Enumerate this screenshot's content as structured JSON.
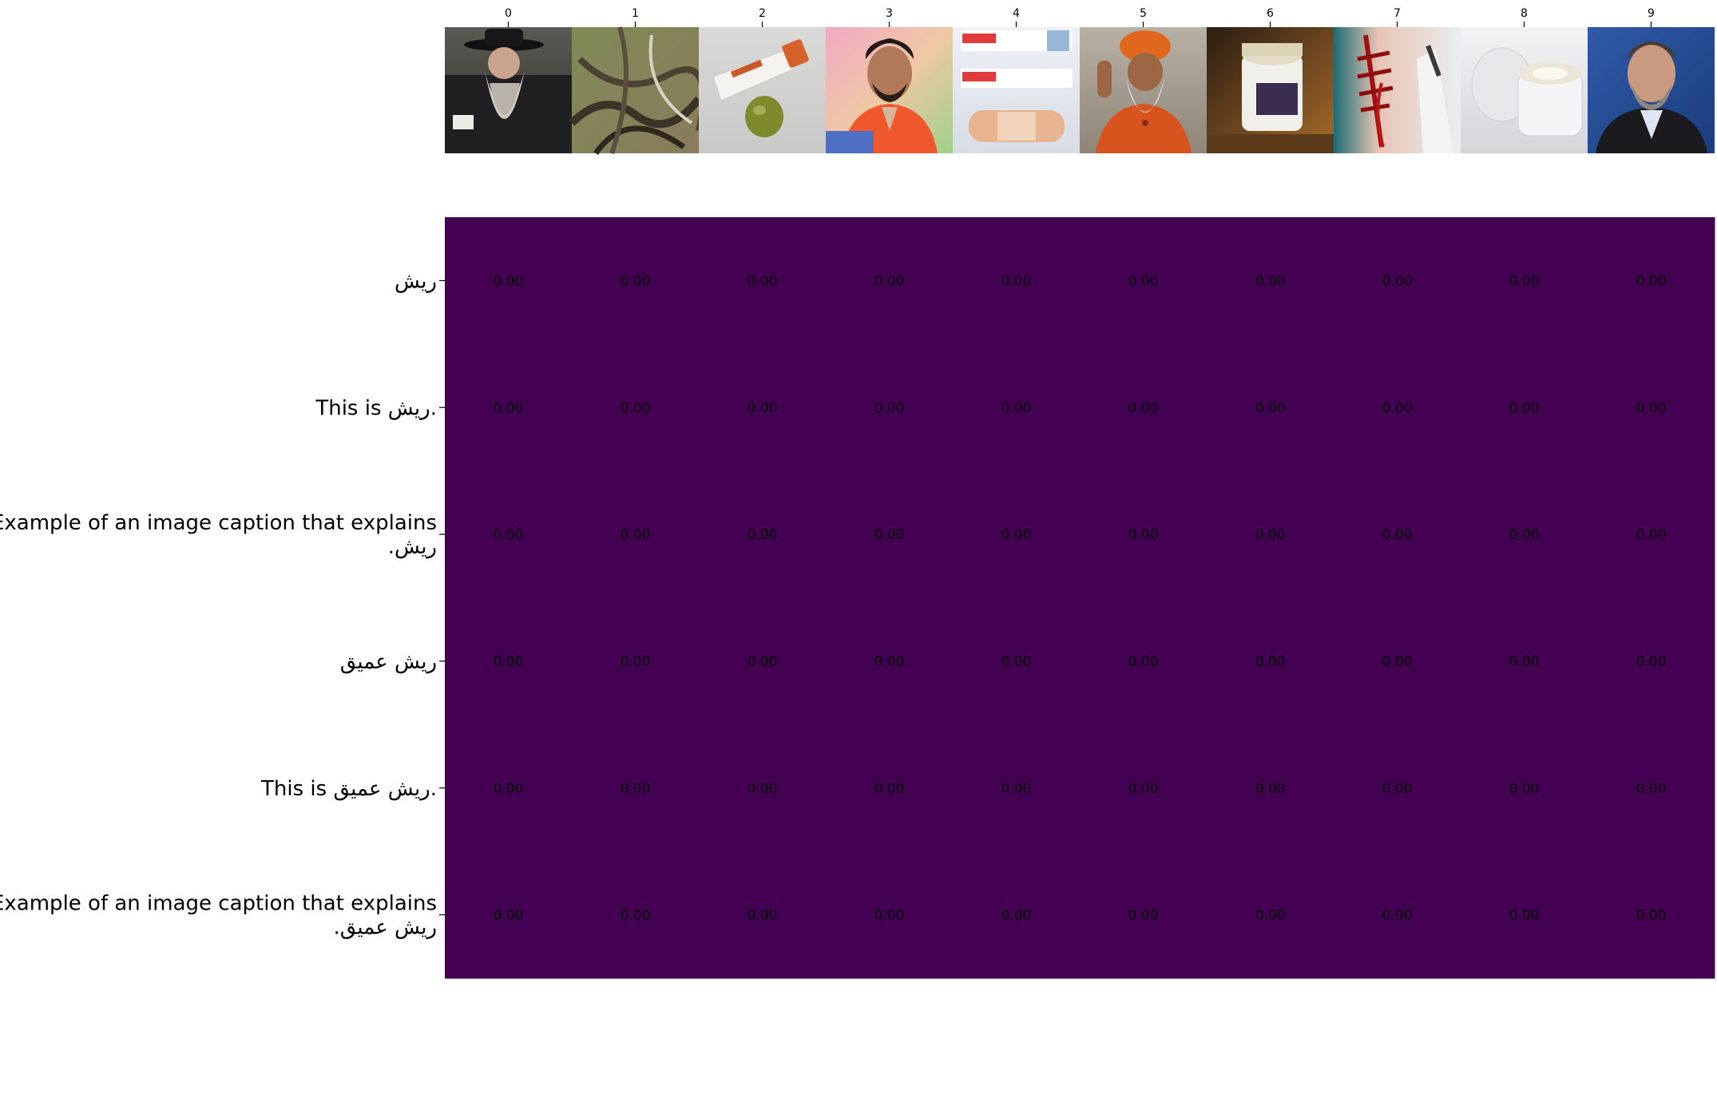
{
  "chart_data": {
    "type": "heatmap",
    "title": "",
    "xlabel": "",
    "ylabel": "",
    "colormap": "viridis",
    "cell_color": "#440154",
    "x_tick_labels": [
      "0",
      "1",
      "2",
      "3",
      "4",
      "5",
      "6",
      "7",
      "8",
      "9"
    ],
    "column_images": [
      "man-with-long-grey-beard-and-black-hat",
      "tangled-dry-tree-roots",
      "ointment-tube-with-green-gel",
      "man-with-beard-in-orange-shirt",
      "band-aid-adhesive-bandage",
      "sadhu-with-white-beard-and-orange-turban",
      "cream-jar-on-table",
      "bleeding-cut-on-arm",
      "open-white-cream-jar",
      "smiling-man-with-grey-beard"
    ],
    "rows": [
      "ریش",
      "This is ریش.",
      "Example of an image caption that explains\nریش.",
      "ریش عمیق",
      "This is ریش عمیق.",
      "Example of an image caption that explains\nریش عمیق."
    ],
    "values": [
      [
        0.0,
        0.0,
        0.0,
        0.0,
        0.0,
        0.0,
        0.0,
        0.0,
        0.0,
        0.0
      ],
      [
        0.0,
        0.0,
        0.0,
        0.0,
        0.0,
        0.0,
        0.0,
        0.0,
        0.0,
        0.0
      ],
      [
        0.0,
        0.0,
        0.0,
        0.0,
        0.0,
        0.0,
        0.0,
        0.0,
        0.0,
        0.0
      ],
      [
        0.0,
        0.0,
        0.0,
        0.0,
        0.0,
        0.0,
        0.0,
        0.0,
        0.0,
        0.0
      ],
      [
        0.0,
        0.0,
        0.0,
        0.0,
        0.0,
        0.0,
        0.0,
        0.0,
        0.0,
        0.0
      ],
      [
        0.0,
        0.0,
        0.0,
        0.0,
        0.0,
        0.0,
        0.0,
        0.0,
        0.0,
        0.0
      ]
    ],
    "value_format": "0.00",
    "grid": false,
    "legend": "none"
  }
}
